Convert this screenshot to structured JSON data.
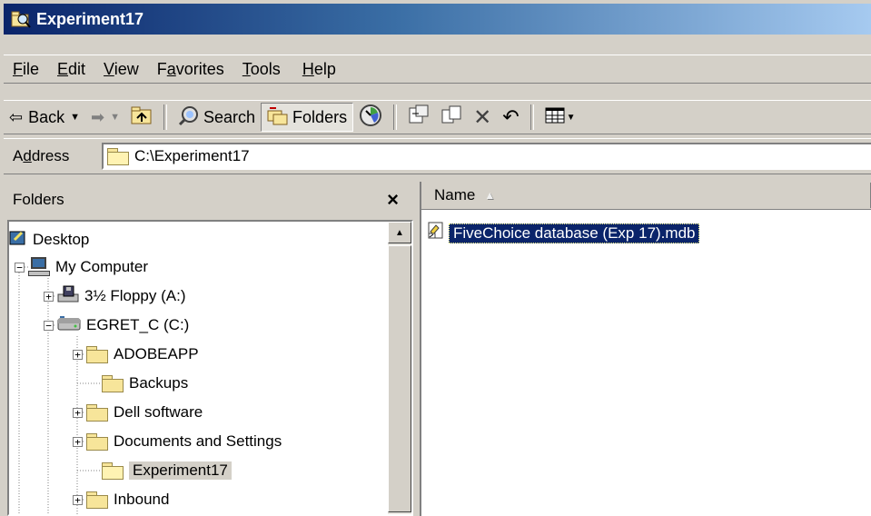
{
  "window": {
    "title": "Experiment17"
  },
  "menu": {
    "items": [
      {
        "pre": "",
        "u": "F",
        "post": "ile"
      },
      {
        "pre": "",
        "u": "E",
        "post": "dit"
      },
      {
        "pre": "",
        "u": "V",
        "post": "iew"
      },
      {
        "pre": "F",
        "u": "a",
        "post": "vorites"
      },
      {
        "pre": "",
        "u": "T",
        "post": "ools"
      },
      {
        "pre": "",
        "u": "H",
        "post": "elp"
      }
    ]
  },
  "toolbar": {
    "back_label": "Back",
    "search_label": "Search",
    "folders_label": "Folders"
  },
  "address": {
    "label_pre": "A",
    "label_u": "d",
    "label_post": "dress",
    "value": "C:\\Experiment17"
  },
  "folders_pane": {
    "title": "Folders",
    "close_glyph": "×",
    "tree": {
      "desktop": "Desktop",
      "my_computer": "My Computer",
      "floppy": "3½ Floppy (A:)",
      "drive_c": "EGRET_C (C:)",
      "folders": [
        "ADOBEAPP",
        "Backups",
        "Dell software",
        "Documents and Settings",
        "Experiment17",
        "Inbound"
      ]
    }
  },
  "file_list": {
    "column_name": "Name",
    "sort_glyph": "▲",
    "files": [
      {
        "name": "FiveChoice database (Exp 17).mdb"
      }
    ]
  },
  "colors": {
    "title_start": "#0a246a",
    "selection": "#0a246a",
    "face": "#d4d0c8"
  }
}
